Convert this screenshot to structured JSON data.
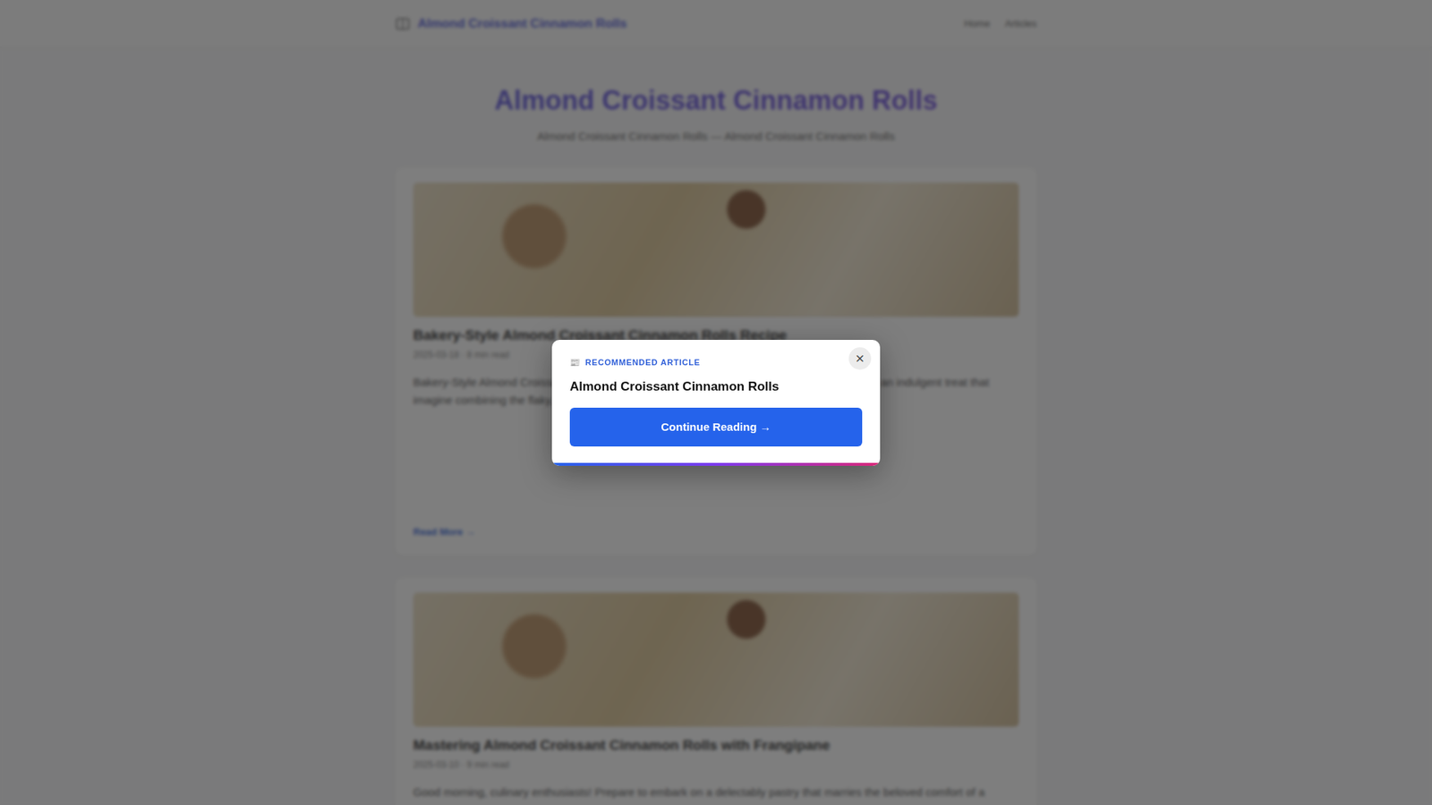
{
  "header": {
    "logo": "Almond Croissant Cinnamon Rolls",
    "nav": [
      "Home",
      "Articles"
    ]
  },
  "hero": {
    "title": "Almond Croissant Cinnamon Rolls",
    "subtitle": "Almond Croissant Cinnamon Rolls — Almond Croissant Cinnamon Rolls"
  },
  "articles": [
    {
      "title": "Bakery-Style Almond Croissant Cinnamon Rolls Recipe",
      "meta": "2025-03-18 · 8 min read",
      "excerpt": "Bakery-Style Almond Croissant Cinnamon Rolls are an elegant fusion of two beloved pastries, an indulgent treat that imagine combining the flaky, buttery elegance of croissants with sweet almond filling.",
      "link": "Read More →"
    },
    {
      "title": "Mastering Almond Croissant Cinnamon Rolls with Frangipane",
      "meta": "2025-03-10 · 9 min read",
      "excerpt": "Good morning, culinary enthusiasts! Prepare to embark on a delectably pastry that marries the beloved comfort of a",
      "link": ""
    }
  ],
  "modal": {
    "icon": "📰",
    "label": "RECOMMENDED ARTICLE",
    "title": "Almond Croissant Cinnamon Rolls",
    "button": "Continue Reading →",
    "close": "×"
  }
}
